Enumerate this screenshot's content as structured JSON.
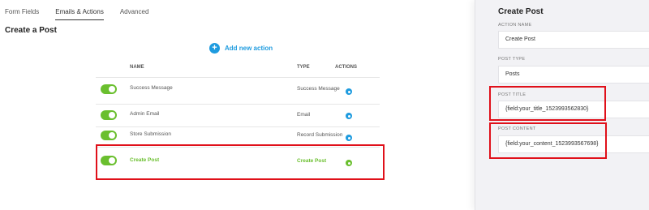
{
  "tabs": [
    "Form Fields",
    "Emails & Actions",
    "Advanced"
  ],
  "page_title": "Create a Post",
  "add_action_label": "Add new action",
  "table": {
    "headers": {
      "name": "NAME",
      "type": "TYPE",
      "actions": "ACTIONS"
    },
    "rows": [
      {
        "name": "Success Message",
        "type": "Success Message",
        "enabled": true
      },
      {
        "name": "Admin Email",
        "type": "Email",
        "enabled": true
      },
      {
        "name": "Store Submission",
        "type": "Record Submission",
        "enabled": true
      },
      {
        "name": "Create Post",
        "type": "Create Post",
        "enabled": true,
        "active": true
      }
    ]
  },
  "panel": {
    "title": "Create Post",
    "fields": [
      {
        "label": "ACTION NAME",
        "value": "Create Post"
      },
      {
        "label": "POST TYPE",
        "value": "Posts"
      },
      {
        "label": "POST TITLE",
        "value": "{field:your_title_1523993562830}"
      },
      {
        "label": "POST CONTENT",
        "value": "{field:your_content_1523993567698}"
      }
    ]
  },
  "colors": {
    "accent": "#1e9bdf",
    "toggle": "#6abf2e",
    "highlight": "#e0101a"
  }
}
